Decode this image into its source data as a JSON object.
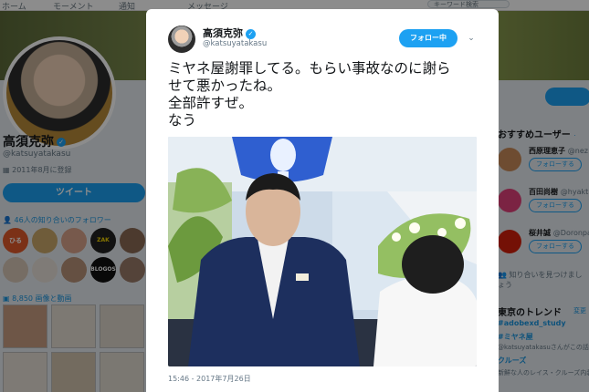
{
  "nav": {
    "home": "ホーム",
    "moments": "モーメント",
    "notifications": "通知",
    "messages": "メッセージ",
    "search_placeholder": "キーワード検索"
  },
  "profile": {
    "name": "高須克弥",
    "handle": "@katsuyatakasu",
    "joined": "2011年8月に登録",
    "tweet_button": "ツイート",
    "known_followers": "46人の知り合いのフォロワー",
    "photos_videos": "8,850 画像と動画",
    "follower_avatars": [
      "ひる",
      "",
      "",
      "",
      "",
      "",
      "",
      "BLOGOS",
      ""
    ],
    "follower_logo_zakzak": "ZAK ZAK"
  },
  "tweet": {
    "name": "高須克弥",
    "handle": "@katsuyatakasu",
    "follow_state": "フォロー中",
    "text_lines": [
      "ミヤネ屋謝罪してる。もらい事故なのに謝ら",
      "せて悪かったね。",
      "全部許すぜ。",
      "なう"
    ],
    "timestamp": "15:46 - 2017年7月26日"
  },
  "recommended": {
    "title": "おすすめユーザー",
    "sep": "·",
    "users": [
      {
        "name": "西原理恵子",
        "handle": "@nez",
        "button": "フォローする",
        "color": "#c98a5a"
      },
      {
        "name": "百田尚樹",
        "handle": "@hyakt",
        "button": "フォローする",
        "color": "#e0417a"
      },
      {
        "name": "桜井誠",
        "handle": "@Doronpa",
        "button": "フォローする",
        "color": "#d4200c"
      }
    ],
    "find_friends": "知り合いを見つけましょう"
  },
  "trends": {
    "title": "東京のトレンド",
    "change": "変更",
    "items": [
      {
        "text": "#adobexd_study",
        "kind": "tag"
      },
      {
        "text": "#ミヤネ屋",
        "kind": "tag"
      },
      {
        "text": "@katsuyatakasuさんがこの話",
        "kind": "sub"
      },
      {
        "text": "クルーズ",
        "kind": "tag"
      },
      {
        "text": "新鮮な人のレイス・クルーズ内装",
        "kind": "sub"
      },
      {
        "text": "",
        "kind": "tag"
      }
    ]
  },
  "colors": {
    "accent": "#1da1f2",
    "link": "#1b95e0",
    "text": "#14171a",
    "muted": "#657786"
  }
}
